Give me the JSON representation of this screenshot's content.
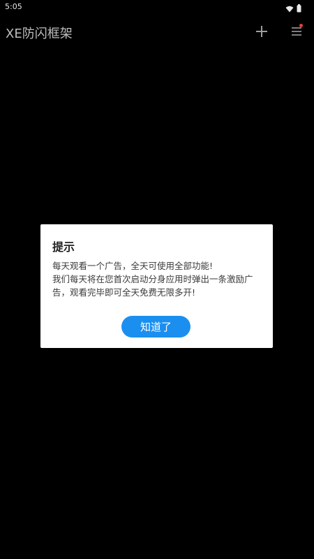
{
  "status_bar": {
    "time": "5:05",
    "icons": [
      "wifi-icon",
      "battery-icon"
    ]
  },
  "app_bar": {
    "title": "XE防闪框架",
    "actions": [
      "add-icon",
      "menu-icon"
    ],
    "notification_dot": true
  },
  "dialog": {
    "title": "提示",
    "message": "每天观看一个广告，全天可使用全部功能!\n我们每天将在您首次启动分身应用时弹出一条激励广告，观看完毕即可全天免费无限多开!",
    "button_label": "知道了"
  },
  "colors": {
    "background": "#000000",
    "dialog_bg": "#ffffff",
    "accent": "#1a8ff0",
    "notification_dot": "#e0413a",
    "title_text": "#bdbdbd",
    "icon": "#9e9e9e"
  }
}
